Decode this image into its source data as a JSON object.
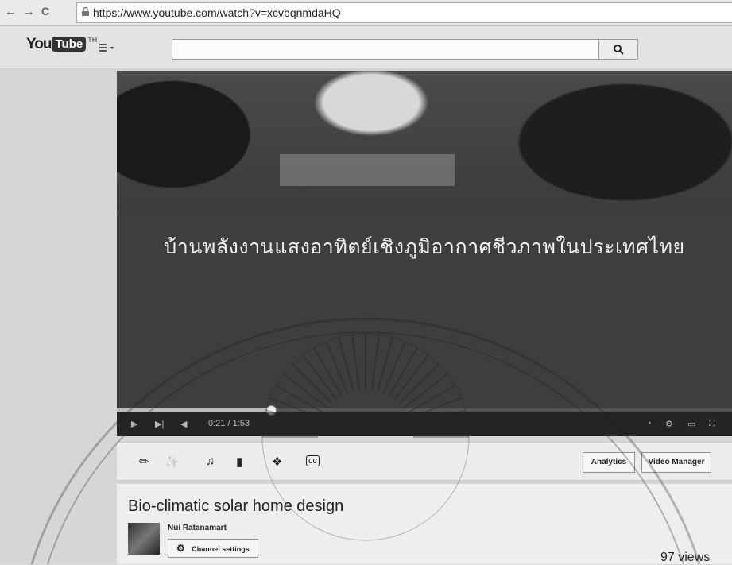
{
  "browser": {
    "url": "https://www.youtube.com/watch?v=xcvbqnmdaHQ",
    "back_icon": "arrow-left-icon",
    "forward_icon": "arrow-right-icon",
    "reload_icon": "reload-icon"
  },
  "header": {
    "logo_you": "You",
    "logo_tube": "Tube",
    "logo_tm": "TH",
    "search_placeholder": ""
  },
  "player": {
    "overlay_title": "บ้านพลังงานแสงอาทิตย์เชิงภูมิอากาศชีวภาพในประเทศไทย",
    "time_display": "0:21 / 1:53",
    "progress_fraction": 0.25
  },
  "edit_toolbar": {
    "tools": [
      "pencil-icon",
      "magic-wand-icon",
      "music-note-icon",
      "annotation-icon",
      "info-icon",
      "cc-icon"
    ],
    "analytics_label": "Analytics",
    "video_manager_label": "Video Manager"
  },
  "video_info": {
    "title": "Bio-climatic solar home design",
    "channel_name": "Nui Ratanamart",
    "channel_settings_label": "Channel settings",
    "views": "97 views"
  }
}
